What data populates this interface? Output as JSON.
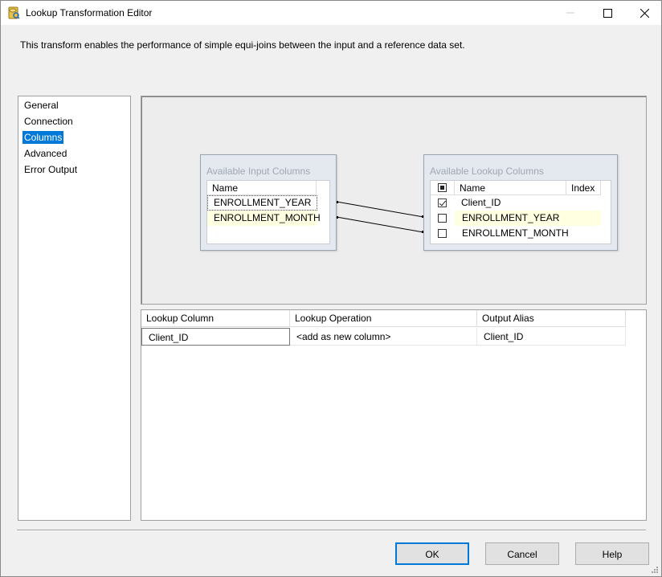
{
  "window": {
    "title": "Lookup Transformation Editor",
    "description": "This transform enables the performance of simple equi-joins between the input and a reference data set."
  },
  "nav": {
    "items": [
      {
        "label": "General",
        "selected": false
      },
      {
        "label": "Connection",
        "selected": false
      },
      {
        "label": "Columns",
        "selected": true
      },
      {
        "label": "Advanced",
        "selected": false
      },
      {
        "label": "Error Output",
        "selected": false
      }
    ]
  },
  "input_columns": {
    "title": "Available Input Columns",
    "header_name": "Name",
    "rows": [
      "ENROLLMENT_YEAR",
      "ENROLLMENT_MONTH"
    ]
  },
  "lookup_columns": {
    "title": "Available Lookup Columns",
    "header_name": "Name",
    "header_index": "Index",
    "rows": [
      {
        "name": "Client_ID",
        "checked": true
      },
      {
        "name": "ENROLLMENT_YEAR",
        "checked": false
      },
      {
        "name": "ENROLLMENT_MONTH",
        "checked": false
      }
    ]
  },
  "mapping_grid": {
    "headers": [
      "Lookup Column",
      "Lookup Operation",
      "Output Alias"
    ],
    "rows": [
      {
        "lookup_column": "Client_ID",
        "lookup_operation": "<add as new column>",
        "output_alias": "Client_ID"
      }
    ]
  },
  "buttons": {
    "ok": "OK",
    "cancel": "Cancel",
    "help": "Help"
  },
  "colors": {
    "selection": "#0078d7",
    "highlight_row": "#ffffe1",
    "panel_title": "#a0a8b4"
  }
}
